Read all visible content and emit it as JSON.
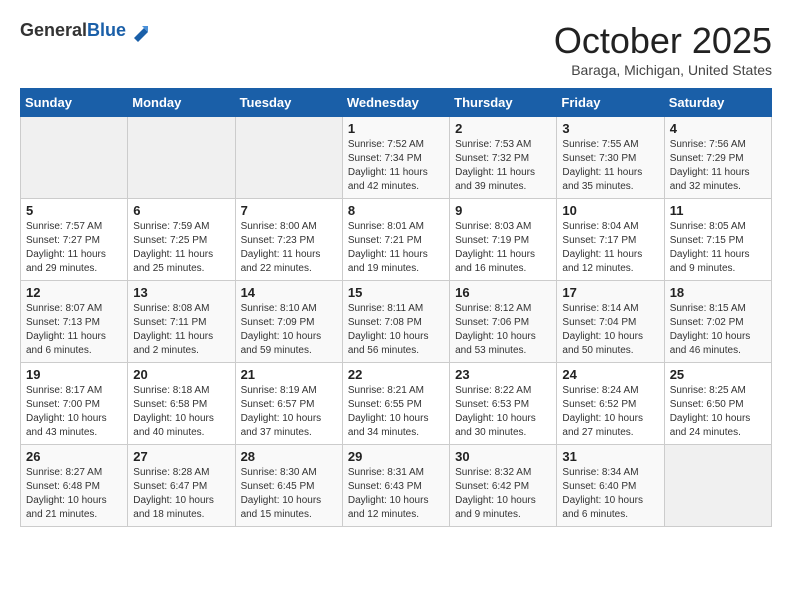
{
  "header": {
    "logo_general": "General",
    "logo_blue": "Blue",
    "month_title": "October 2025",
    "location": "Baraga, Michigan, United States"
  },
  "days_of_week": [
    "Sunday",
    "Monday",
    "Tuesday",
    "Wednesday",
    "Thursday",
    "Friday",
    "Saturday"
  ],
  "weeks": [
    [
      {
        "day": "",
        "info": ""
      },
      {
        "day": "",
        "info": ""
      },
      {
        "day": "",
        "info": ""
      },
      {
        "day": "1",
        "info": "Sunrise: 7:52 AM\nSunset: 7:34 PM\nDaylight: 11 hours and 42 minutes."
      },
      {
        "day": "2",
        "info": "Sunrise: 7:53 AM\nSunset: 7:32 PM\nDaylight: 11 hours and 39 minutes."
      },
      {
        "day": "3",
        "info": "Sunrise: 7:55 AM\nSunset: 7:30 PM\nDaylight: 11 hours and 35 minutes."
      },
      {
        "day": "4",
        "info": "Sunrise: 7:56 AM\nSunset: 7:29 PM\nDaylight: 11 hours and 32 minutes."
      }
    ],
    [
      {
        "day": "5",
        "info": "Sunrise: 7:57 AM\nSunset: 7:27 PM\nDaylight: 11 hours and 29 minutes."
      },
      {
        "day": "6",
        "info": "Sunrise: 7:59 AM\nSunset: 7:25 PM\nDaylight: 11 hours and 25 minutes."
      },
      {
        "day": "7",
        "info": "Sunrise: 8:00 AM\nSunset: 7:23 PM\nDaylight: 11 hours and 22 minutes."
      },
      {
        "day": "8",
        "info": "Sunrise: 8:01 AM\nSunset: 7:21 PM\nDaylight: 11 hours and 19 minutes."
      },
      {
        "day": "9",
        "info": "Sunrise: 8:03 AM\nSunset: 7:19 PM\nDaylight: 11 hours and 16 minutes."
      },
      {
        "day": "10",
        "info": "Sunrise: 8:04 AM\nSunset: 7:17 PM\nDaylight: 11 hours and 12 minutes."
      },
      {
        "day": "11",
        "info": "Sunrise: 8:05 AM\nSunset: 7:15 PM\nDaylight: 11 hours and 9 minutes."
      }
    ],
    [
      {
        "day": "12",
        "info": "Sunrise: 8:07 AM\nSunset: 7:13 PM\nDaylight: 11 hours and 6 minutes."
      },
      {
        "day": "13",
        "info": "Sunrise: 8:08 AM\nSunset: 7:11 PM\nDaylight: 11 hours and 2 minutes."
      },
      {
        "day": "14",
        "info": "Sunrise: 8:10 AM\nSunset: 7:09 PM\nDaylight: 10 hours and 59 minutes."
      },
      {
        "day": "15",
        "info": "Sunrise: 8:11 AM\nSunset: 7:08 PM\nDaylight: 10 hours and 56 minutes."
      },
      {
        "day": "16",
        "info": "Sunrise: 8:12 AM\nSunset: 7:06 PM\nDaylight: 10 hours and 53 minutes."
      },
      {
        "day": "17",
        "info": "Sunrise: 8:14 AM\nSunset: 7:04 PM\nDaylight: 10 hours and 50 minutes."
      },
      {
        "day": "18",
        "info": "Sunrise: 8:15 AM\nSunset: 7:02 PM\nDaylight: 10 hours and 46 minutes."
      }
    ],
    [
      {
        "day": "19",
        "info": "Sunrise: 8:17 AM\nSunset: 7:00 PM\nDaylight: 10 hours and 43 minutes."
      },
      {
        "day": "20",
        "info": "Sunrise: 8:18 AM\nSunset: 6:58 PM\nDaylight: 10 hours and 40 minutes."
      },
      {
        "day": "21",
        "info": "Sunrise: 8:19 AM\nSunset: 6:57 PM\nDaylight: 10 hours and 37 minutes."
      },
      {
        "day": "22",
        "info": "Sunrise: 8:21 AM\nSunset: 6:55 PM\nDaylight: 10 hours and 34 minutes."
      },
      {
        "day": "23",
        "info": "Sunrise: 8:22 AM\nSunset: 6:53 PM\nDaylight: 10 hours and 30 minutes."
      },
      {
        "day": "24",
        "info": "Sunrise: 8:24 AM\nSunset: 6:52 PM\nDaylight: 10 hours and 27 minutes."
      },
      {
        "day": "25",
        "info": "Sunrise: 8:25 AM\nSunset: 6:50 PM\nDaylight: 10 hours and 24 minutes."
      }
    ],
    [
      {
        "day": "26",
        "info": "Sunrise: 8:27 AM\nSunset: 6:48 PM\nDaylight: 10 hours and 21 minutes."
      },
      {
        "day": "27",
        "info": "Sunrise: 8:28 AM\nSunset: 6:47 PM\nDaylight: 10 hours and 18 minutes."
      },
      {
        "day": "28",
        "info": "Sunrise: 8:30 AM\nSunset: 6:45 PM\nDaylight: 10 hours and 15 minutes."
      },
      {
        "day": "29",
        "info": "Sunrise: 8:31 AM\nSunset: 6:43 PM\nDaylight: 10 hours and 12 minutes."
      },
      {
        "day": "30",
        "info": "Sunrise: 8:32 AM\nSunset: 6:42 PM\nDaylight: 10 hours and 9 minutes."
      },
      {
        "day": "31",
        "info": "Sunrise: 8:34 AM\nSunset: 6:40 PM\nDaylight: 10 hours and 6 minutes."
      },
      {
        "day": "",
        "info": ""
      }
    ]
  ],
  "colors": {
    "header_bg": "#1a5fa8",
    "header_text": "#ffffff",
    "odd_row": "#f9f9f9",
    "even_row": "#ffffff",
    "empty_cell": "#f0f0f0"
  }
}
